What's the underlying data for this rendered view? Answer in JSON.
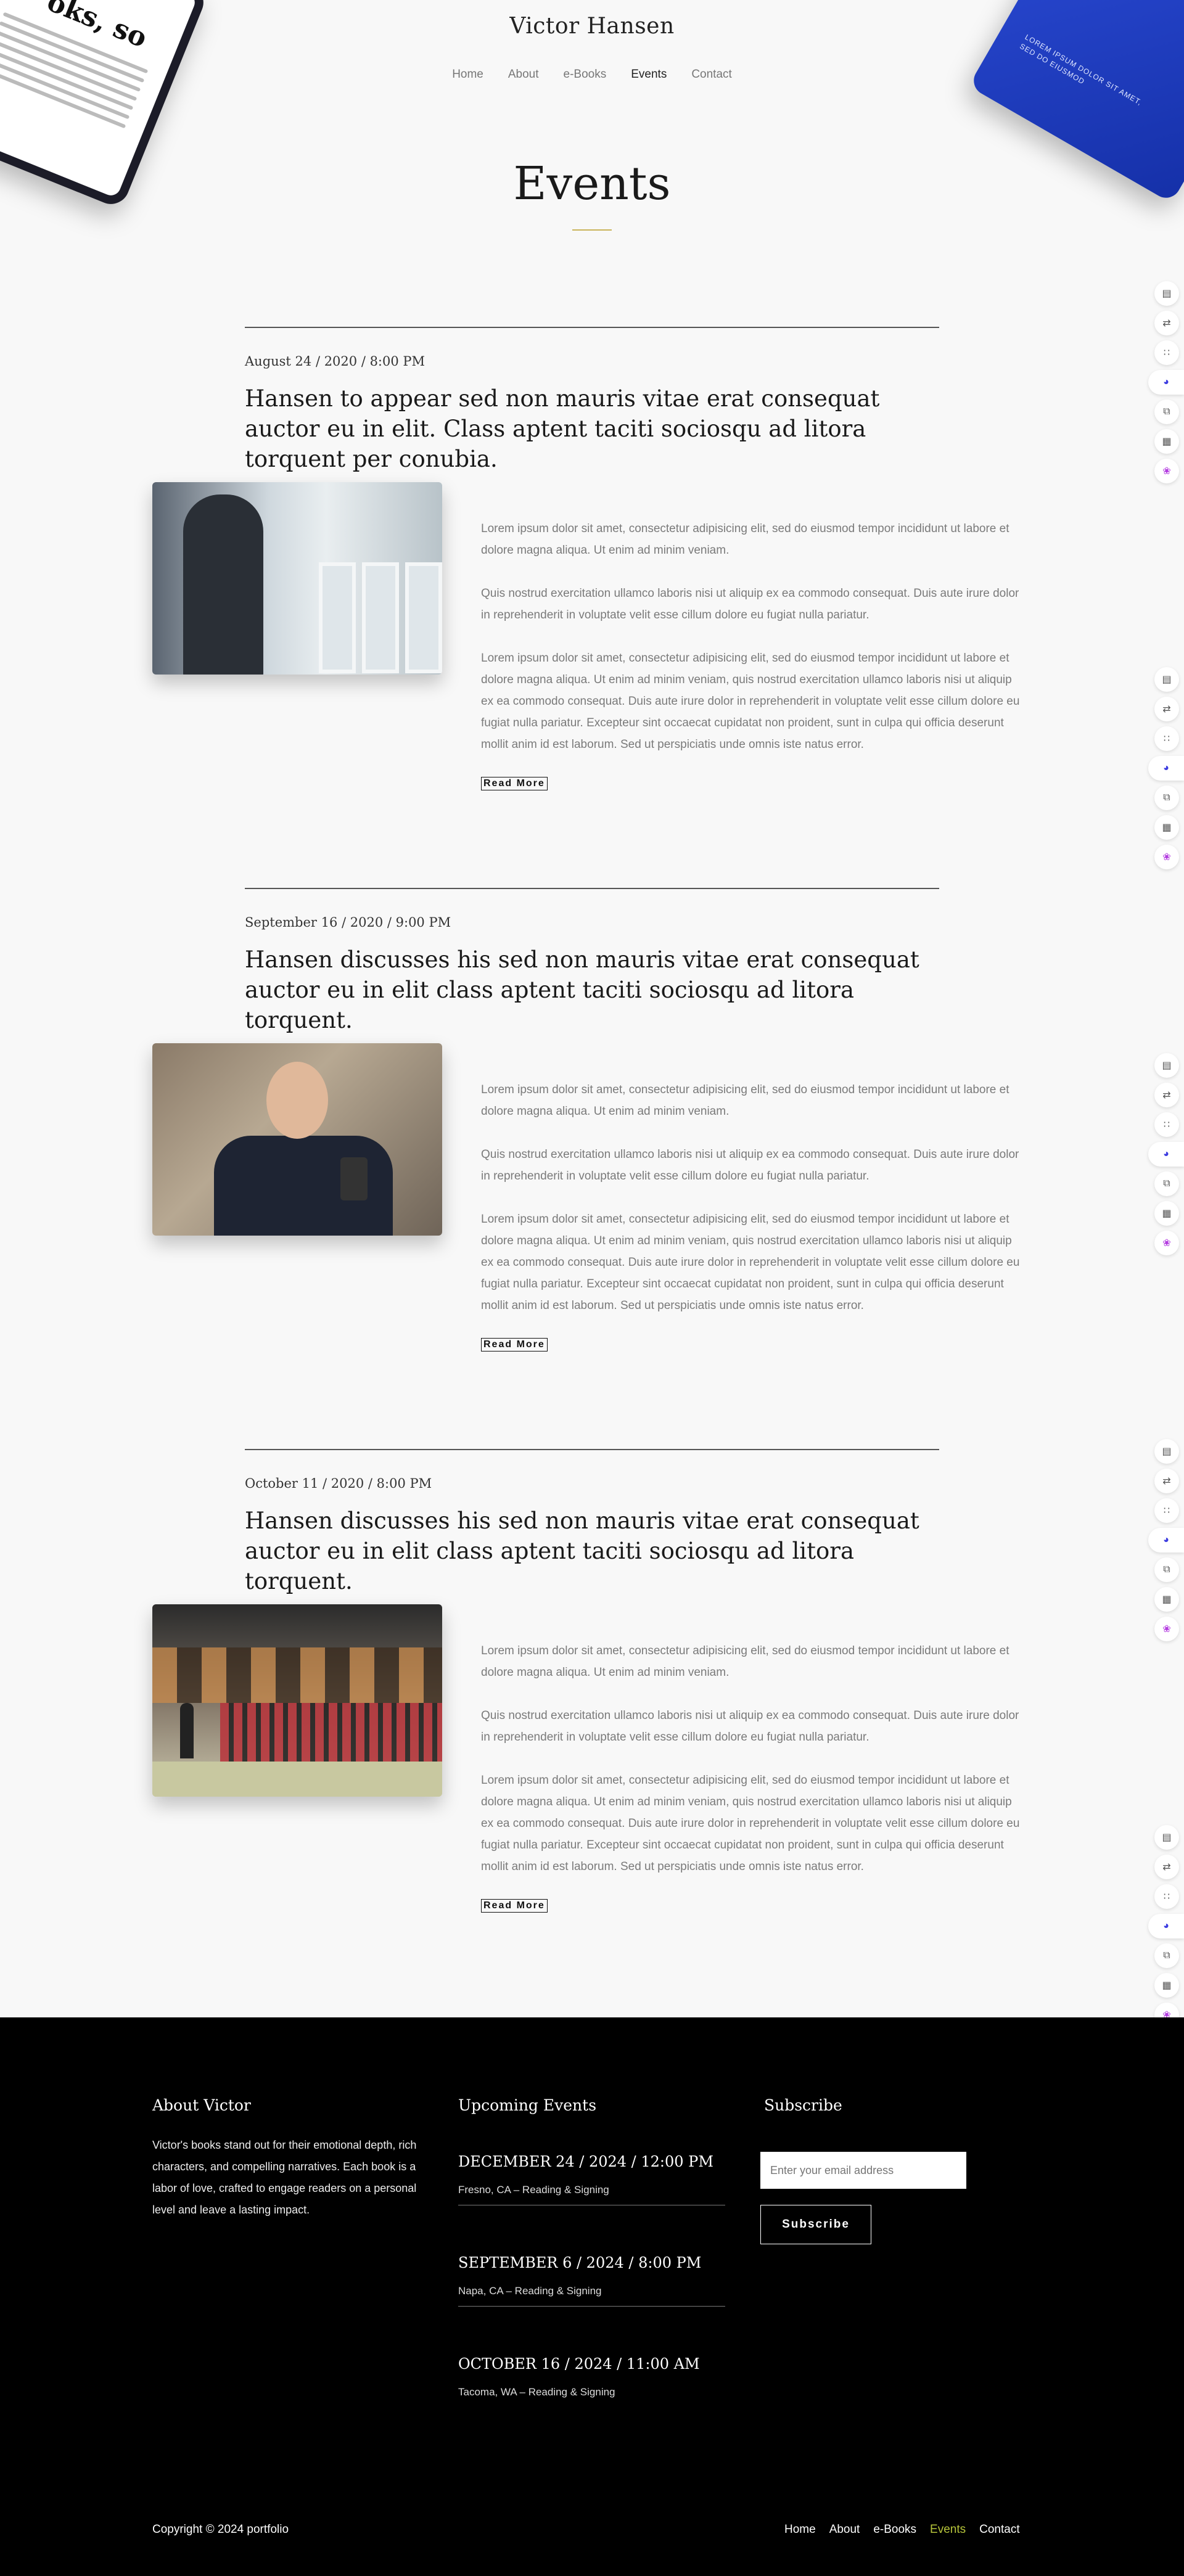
{
  "site": {
    "title": "Victor Hansen"
  },
  "nav": {
    "items": [
      {
        "label": "Home"
      },
      {
        "label": "About"
      },
      {
        "label": "e-Books"
      },
      {
        "label": "Events"
      },
      {
        "label": "Contact"
      }
    ],
    "active": "Events"
  },
  "page": {
    "title": "Events"
  },
  "decor": {
    "book_left_text": "oks, so",
    "book_right_text": "LOREM IPSUM DOLOR SIT AMET, SED DO EIUSMOD"
  },
  "events": [
    {
      "date": "August 24 / 2020 / 8:00 PM",
      "heading": "Hansen to appear sed non mauris vitae erat consequat auctor eu in elit. Class aptent taciti sociosqu ad litora torquent per conubia.",
      "paragraphs": [
        "Lorem ipsum dolor sit amet, consectetur adipisicing elit, sed do eiusmod tempor incididunt ut labore et dolore magna aliqua. Ut enim ad minim veniam.",
        "Quis nostrud exercitation ullamco laboris nisi ut aliquip ex ea commodo consequat. Duis aute irure dolor in reprehenderit in voluptate velit esse cillum dolore eu fugiat nulla pariatur.",
        "Lorem ipsum dolor sit amet, consectetur adipisicing elit, sed do eiusmod tempor incididunt ut labore et dolore magna aliqua. Ut enim ad minim veniam, quis nostrud exercitation ullamco laboris nisi ut aliquip ex ea commodo consequat. Duis aute irure dolor in reprehenderit in voluptate velit esse cillum dolore eu fugiat nulla pariatur. Excepteur sint occaecat cupidatat non proident, sunt in culpa qui officia deserunt mollit anim id est laborum. Sed ut perspiciatis unde omnis iste natus error."
      ],
      "read_more": "Read More"
    },
    {
      "date": "September 16 / 2020 / 9:00 PM",
      "heading": "Hansen discusses his sed non mauris vitae erat consequat auctor eu in elit class aptent taciti sociosqu ad litora torquent.",
      "paragraphs": [
        "Lorem ipsum dolor sit amet, consectetur adipisicing elit, sed do eiusmod tempor incididunt ut labore et dolore magna aliqua. Ut enim ad minim veniam.",
        "Quis nostrud exercitation ullamco laboris nisi ut aliquip ex ea commodo consequat. Duis aute irure dolor in reprehenderit in voluptate velit esse cillum dolore eu fugiat nulla pariatur.",
        "Lorem ipsum dolor sit amet, consectetur adipisicing elit, sed do eiusmod tempor incididunt ut labore et dolore magna aliqua. Ut enim ad minim veniam, quis nostrud exercitation ullamco laboris nisi ut aliquip ex ea commodo consequat. Duis aute irure dolor in reprehenderit in voluptate velit esse cillum dolore eu fugiat nulla pariatur. Excepteur sint occaecat cupidatat non proident, sunt in culpa qui officia deserunt mollit anim id est laborum. Sed ut perspiciatis unde omnis iste natus error."
      ],
      "read_more": "Read More"
    },
    {
      "date": "October 11 / 2020 / 8:00 PM",
      "heading": "Hansen discusses his sed non mauris vitae erat consequat auctor eu in elit class aptent taciti sociosqu ad litora torquent.",
      "paragraphs": [
        "Lorem ipsum dolor sit amet, consectetur adipisicing elit, sed do eiusmod tempor incididunt ut labore et dolore magna aliqua. Ut enim ad minim veniam.",
        "Quis nostrud exercitation ullamco laboris nisi ut aliquip ex ea commodo consequat. Duis aute irure dolor in reprehenderit in voluptate velit esse cillum dolore eu fugiat nulla pariatur.",
        "Lorem ipsum dolor sit amet, consectetur adipisicing elit, sed do eiusmod tempor incididunt ut labore et dolore magna aliqua. Ut enim ad minim veniam, quis nostrud exercitation ullamco laboris nisi ut aliquip ex ea commodo consequat. Duis aute irure dolor in reprehenderit in voluptate velit esse cillum dolore eu fugiat nulla pariatur. Excepteur sint occaecat cupidatat non proident, sunt in culpa qui officia deserunt mollit anim id est laborum. Sed ut perspiciatis unde omnis iste natus error."
      ],
      "read_more": "Read More"
    }
  ],
  "footer": {
    "about_title": "About Victor",
    "about_text": "Victor's books stand out for their emotional depth, rich characters, and compelling narratives. Each book is a labor of love, crafted to engage readers on a personal level and leave a lasting impact.",
    "upcoming_title": "Upcoming Events",
    "upcoming": [
      {
        "date": "DECEMBER 24 / 2024 / 12:00 PM",
        "location": "Fresno, CA – Reading & Signing"
      },
      {
        "date": "SEPTEMBER 6 / 2024 / 8:00 PM",
        "location": "Napa, CA – Reading & Signing"
      },
      {
        "date": "OCTOBER 16 / 2024 / 11:00 AM",
        "location": "Tacoma, WA – Reading & Signing"
      }
    ],
    "subscribe_title": "Subscribe",
    "email_placeholder": "Enter your email address",
    "subscribe_button": "Subscribe",
    "copyright": "Copyright © 2024 portfolio",
    "links": [
      {
        "label": "Home"
      },
      {
        "label": "About"
      },
      {
        "label": "e-Books"
      },
      {
        "label": "Events"
      },
      {
        "label": "Contact"
      }
    ],
    "active_link": "Events"
  },
  "colors": {
    "accent_rule": "#c9b45a",
    "footer_active_link": "#b6c43a",
    "footer_bg": "#000000",
    "page_bg": "#f8f8f8"
  },
  "toolbar_icons": [
    "book-icon",
    "translate-icon",
    "apps-icon",
    "chat-bot-icon",
    "copy-icon",
    "reader-icon",
    "brain-icon"
  ]
}
